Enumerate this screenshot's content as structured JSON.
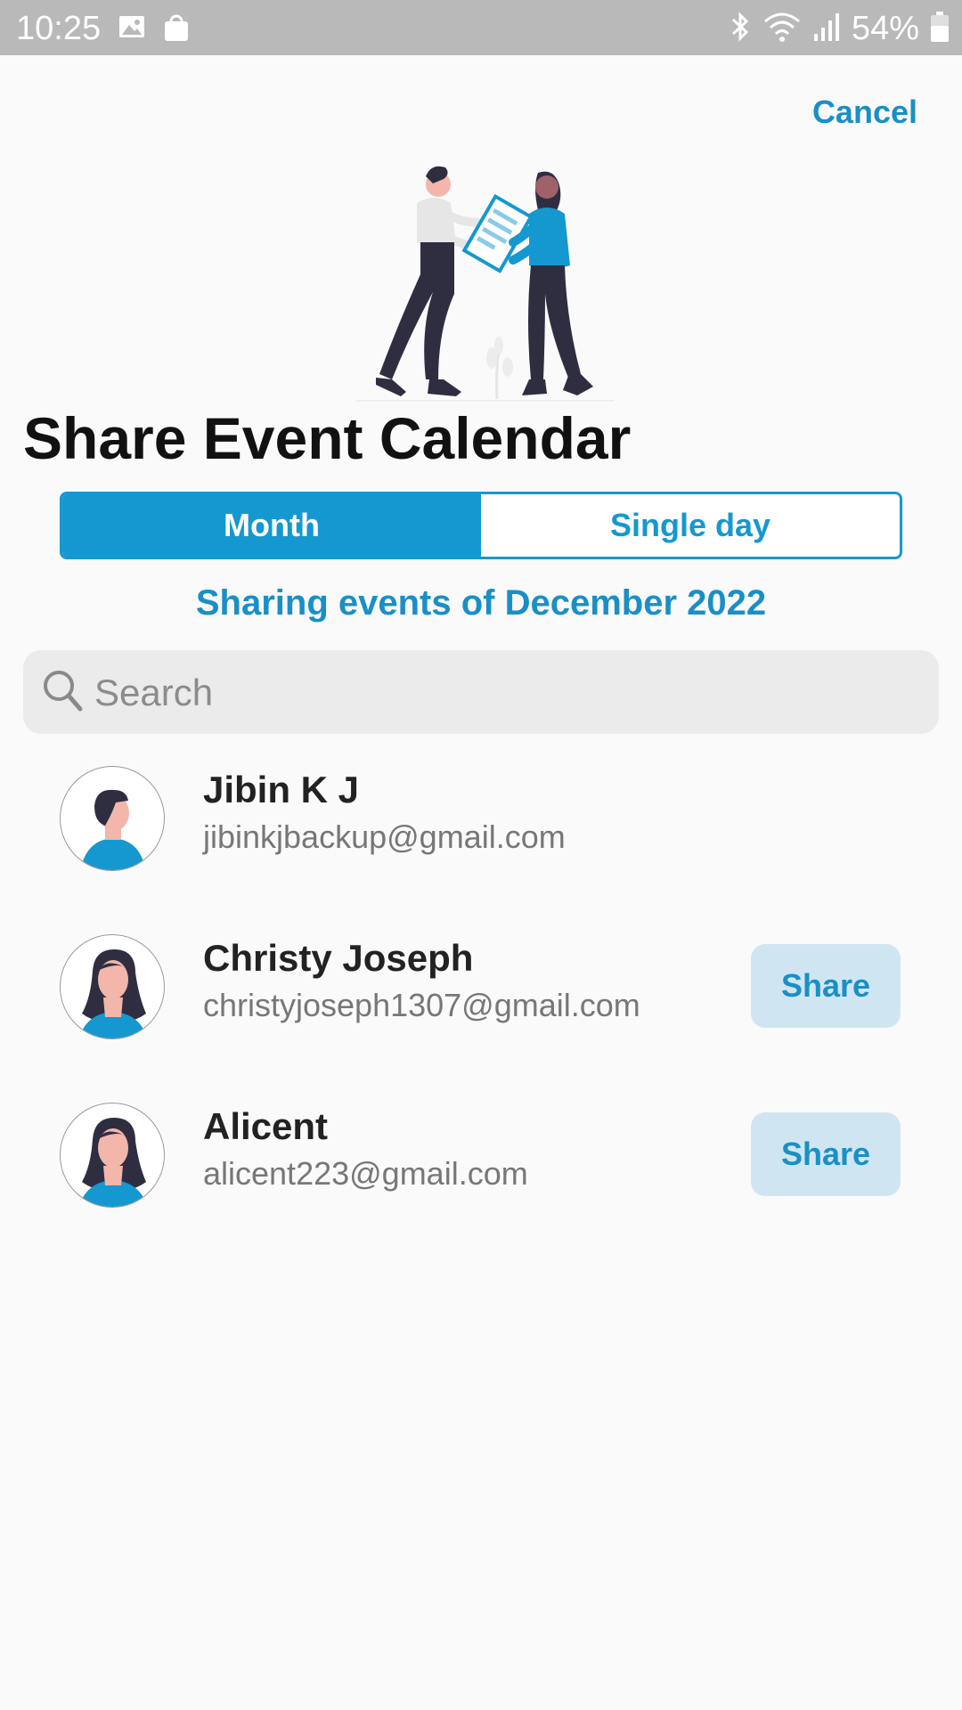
{
  "status_bar": {
    "time": "10:25",
    "battery": "54%",
    "icons": [
      "image-icon",
      "shopping-bag-icon",
      "bluetooth-icon",
      "wifi-icon",
      "signal-icon",
      "battery-icon"
    ]
  },
  "header": {
    "cancel_label": "Cancel"
  },
  "title": "Share Event Calendar",
  "segment": {
    "options": [
      "Month",
      "Single day"
    ],
    "selected": "Month"
  },
  "subtitle": "Sharing events of December 2022",
  "search": {
    "placeholder": "Search",
    "value": ""
  },
  "contacts": [
    {
      "name": "Jibin K J",
      "email": "jibinkjbackup@gmail.com",
      "avatar": "male-avatar-icon",
      "share_label": ""
    },
    {
      "name": "Christy Joseph",
      "email": "christyjoseph1307@gmail.com",
      "avatar": "female-avatar-icon",
      "share_label": "Share"
    },
    {
      "name": "Alicent",
      "email": "alicent223@gmail.com",
      "avatar": "female-avatar-icon",
      "share_label": "Share"
    }
  ],
  "colors": {
    "accent": "#1598d0",
    "share_bg": "#cfe6f2",
    "status_bar": "#b9b9b9",
    "background": "#fafafa"
  }
}
